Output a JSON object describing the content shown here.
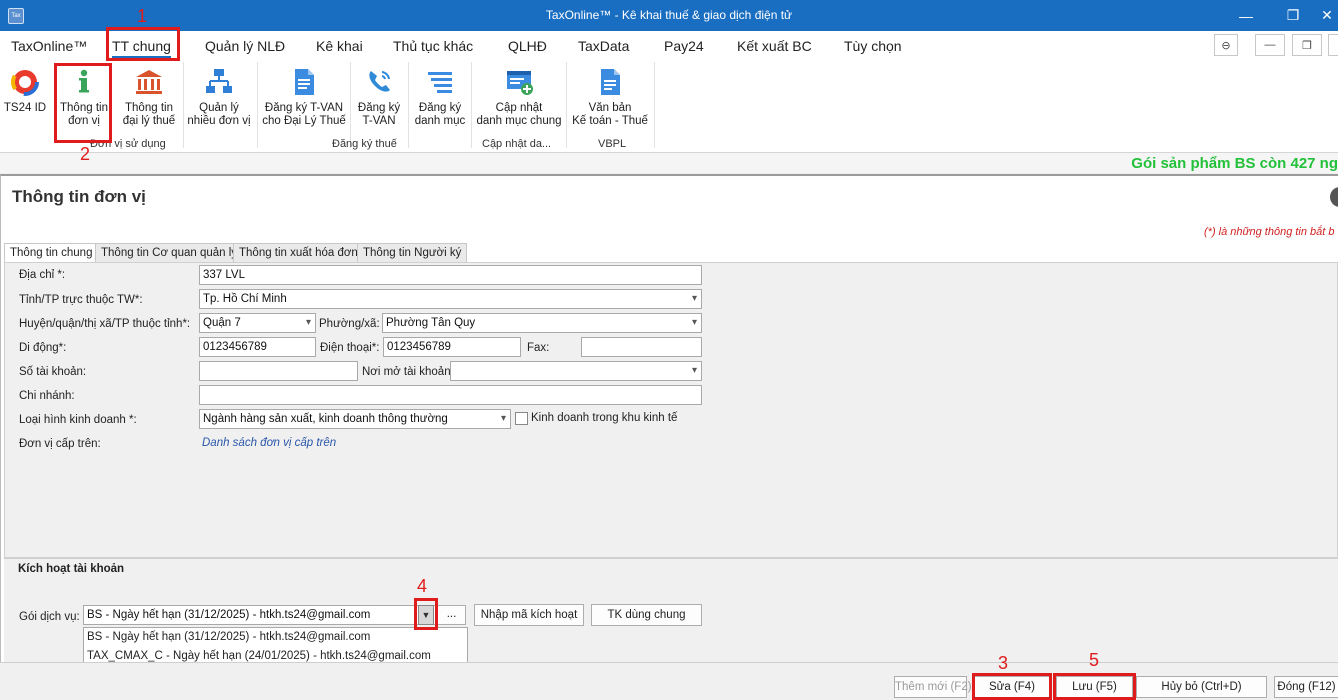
{
  "window": {
    "title": "TaxOnline™ - Kê khai thuế & giao dịch điện tử",
    "icon_text": "Tax"
  },
  "menu": [
    "TaxOnline™",
    "TT chung",
    "Quản lý NLĐ",
    "Kê khai",
    "Thủ tục khác",
    "QLHĐ",
    "TaxData",
    "Pay24",
    "Kết xuất BC",
    "Tùy chọn"
  ],
  "ribbon": {
    "buttons": [
      {
        "label": "TS24 ID",
        "icon": "ts24-logo-icon"
      },
      {
        "label": "Thông tin\nđơn vị",
        "icon": "info-icon"
      },
      {
        "label": "Thông tin\nđại lý thuế",
        "icon": "bank-building-icon"
      },
      {
        "label": "Quản lý\nnhiều đơn vị",
        "icon": "org-chart-icon"
      },
      {
        "label": "Đăng ký T-VAN\ncho Đại Lý Thuế",
        "icon": "document-icon"
      },
      {
        "label": "Đăng ký\nT-VAN",
        "icon": "phone-icon"
      },
      {
        "label": "Đăng ký\ndanh mục",
        "icon": "list-icon"
      },
      {
        "label": "Cập nhật\ndanh mục chung",
        "icon": "update-catalog-icon"
      },
      {
        "label": "Văn bản\nKế toán - Thuế",
        "icon": "legal-doc-icon"
      }
    ],
    "groups": [
      "Đơn vị sử dụng",
      "Đăng ký thuế",
      "Cập nhật da...",
      "VBPL"
    ]
  },
  "promo": "Gói sản phẩm BS còn 427 ng",
  "panel": {
    "title": "Thông tin đơn vị",
    "required_note": "(*) là những thông tin bắt b",
    "tabs": [
      "Thông tin chung",
      "Thông tin Cơ quan quản lý",
      "Thông tin xuất hóa đơn",
      "Thông tin Người ký"
    ]
  },
  "form": {
    "address": {
      "label": "Địa chỉ *:",
      "value": "337 LVL"
    },
    "province": {
      "label": "Tỉnh/TP trực thuộc TW*:",
      "value": "Tp. Hồ Chí Minh"
    },
    "district": {
      "label": "Huyện/quận/thị xã/TP thuộc tỉnh*:",
      "value": "Quận 7"
    },
    "ward": {
      "label": "Phường/xã:",
      "value": "Phường Tân Quy"
    },
    "mobile": {
      "label": "Di động*:",
      "value": "0123456789"
    },
    "phone": {
      "label": "Điện thoại*:",
      "value": "0123456789"
    },
    "fax": {
      "label": "Fax:",
      "value": ""
    },
    "account_no": {
      "label": "Số tài khoản:",
      "value": ""
    },
    "bank": {
      "label": "Nơi mở tài khoản:",
      "value": ""
    },
    "branch": {
      "label": "Chi nhánh:",
      "value": ""
    },
    "business_type": {
      "label": "Loại hình kinh doanh *:",
      "value": "Ngành hàng sản xuất, kinh doanh thông thường"
    },
    "economic_zone": {
      "label": "Kinh doanh trong khu kinh tế",
      "checked": false
    },
    "parent_unit": {
      "label": "Đơn vị cấp trên:",
      "link": "Danh sách đơn vị cấp trên"
    }
  },
  "activation": {
    "title": "Kích hoạt tài khoản",
    "service_label": "Gói dịch vụ:",
    "service_value": "BS - Ngày hết hạn (31/12/2025) - htkh.ts24@gmail.com",
    "ellipsis": "...",
    "enter_code": "Nhập mã kích hoạt",
    "shared_account": "TK dùng chung",
    "options": [
      "BS - Ngày hết hạn (31/12/2025) - htkh.ts24@gmail.com",
      "TAX_CMAX_C - Ngày hết hạn (24/01/2025) - htkh.ts24@gmail.com"
    ]
  },
  "bottom": {
    "add": "Thêm mới (F2)",
    "edit": "Sửa (F4)",
    "save": "Lưu (F5)",
    "cancel": "Hủy bỏ (Ctrl+D)",
    "close": "Đóng (F12)"
  },
  "annotations": [
    "1",
    "2",
    "3",
    "4",
    "5"
  ]
}
